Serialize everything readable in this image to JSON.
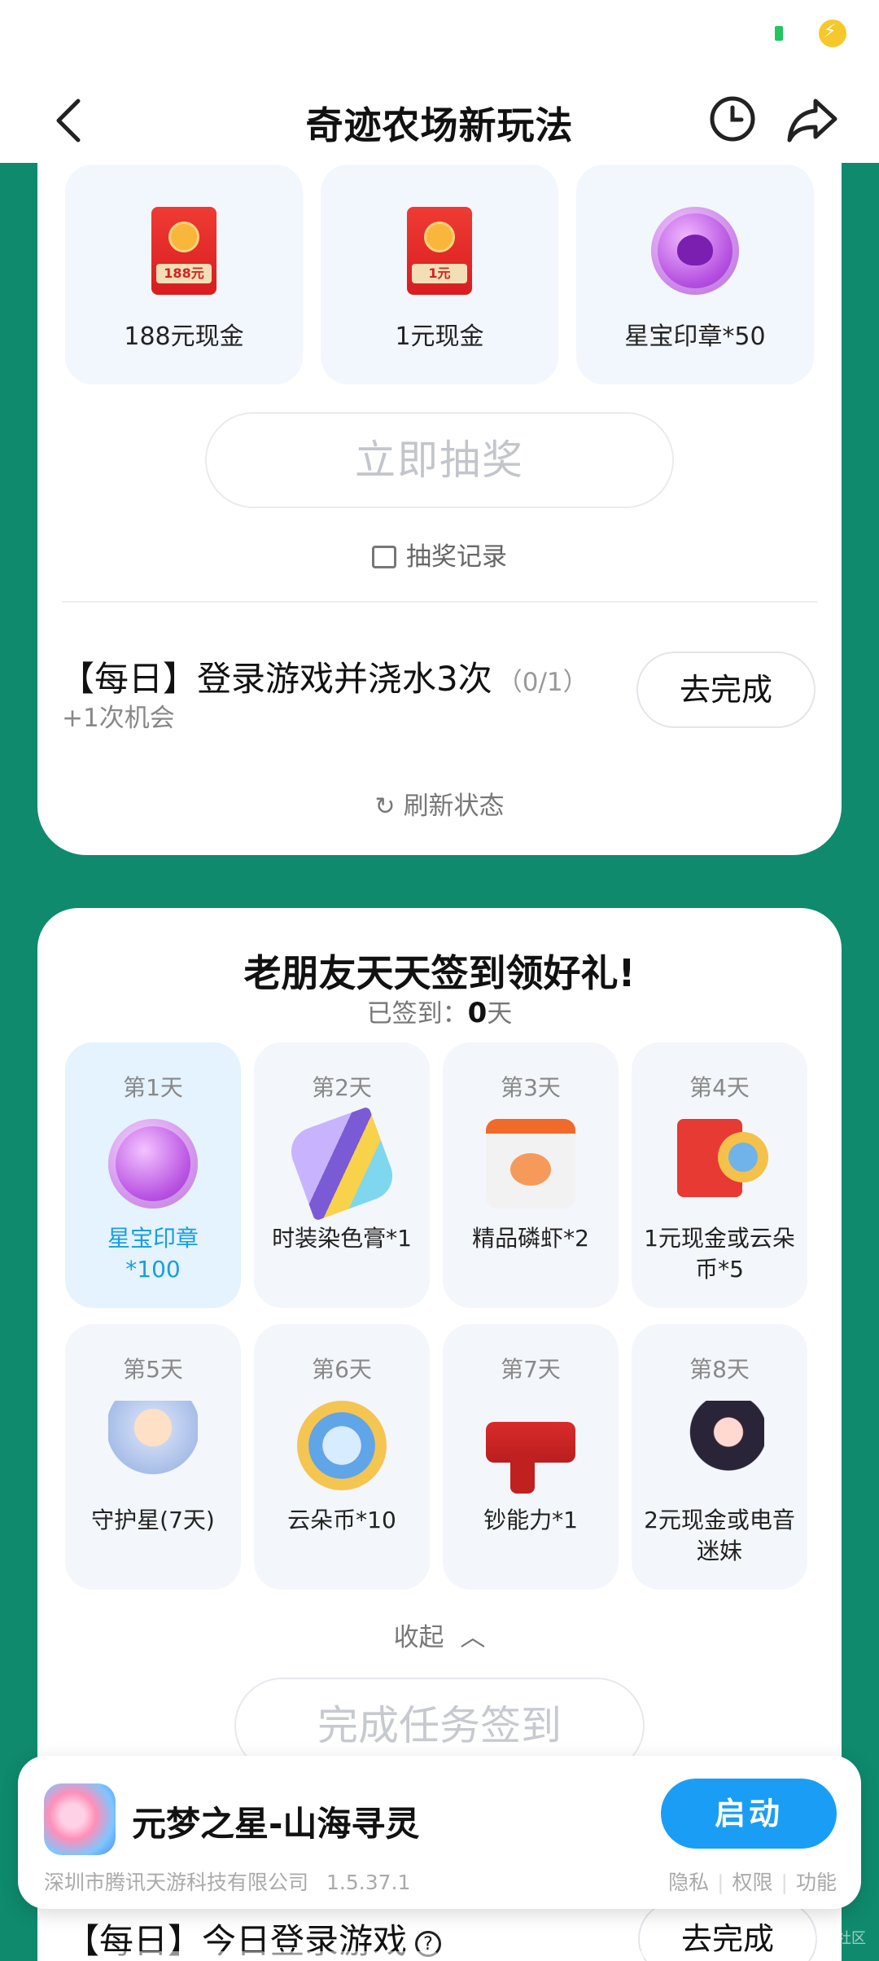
{
  "header": {
    "title": "奇迹农场新玩法"
  },
  "lottery": {
    "prizes": [
      {
        "label": "188元现金",
        "badge": "188元",
        "icon": "red-envelope"
      },
      {
        "label": "1元现金",
        "badge": "1元",
        "icon": "red-envelope"
      },
      {
        "label": "星宝印章*50",
        "icon": "star-seal"
      }
    ],
    "draw_label": "立即抽奖",
    "record_label": "抽奖记录",
    "task": {
      "title": "【每日】登录游戏并浇水3次",
      "progress": "（0/1）",
      "reward": "+1次机会",
      "button": "去完成"
    },
    "refresh_label": "刷新状态"
  },
  "signin": {
    "title": "老朋友天天签到领好礼!",
    "signed_prefix": "已签到：",
    "signed_count": "0",
    "signed_suffix": "天",
    "days": [
      {
        "day": "第1天",
        "name": "星宝印章\n*100",
        "icon": "star-seal"
      },
      {
        "day": "第2天",
        "name": "时装染色膏*1",
        "icon": "dye-tube"
      },
      {
        "day": "第3天",
        "name": "精品磷虾*2",
        "icon": "shrimp-pack"
      },
      {
        "day": "第4天",
        "name": "1元现金或云朵币*5",
        "icon": "envelope-coin"
      },
      {
        "day": "第5天",
        "name": "守护星(7天)",
        "icon": "guardian-doll"
      },
      {
        "day": "第6天",
        "name": "云朵币*10",
        "icon": "cloud-coin"
      },
      {
        "day": "第7天",
        "name": "钞能力*1",
        "icon": "money-gun"
      },
      {
        "day": "第8天",
        "name": "2元现金或电音迷妹",
        "icon": "envelope-girl"
      }
    ],
    "collapse_label": "收起",
    "finish_label": "完成任务签到"
  },
  "bottom_task": {
    "title": "【每日】今日登录游戏",
    "button": "去完成"
  },
  "app": {
    "name": "元梦之星-山海寻灵",
    "launch_label": "启动",
    "developer": "深圳市腾讯天游科技有限公司",
    "version": "1.5.37.1",
    "links": [
      "隐私",
      "权限",
      "功能"
    ]
  },
  "watermark": "游戏社区",
  "colors": {
    "background": "#0f8a6c",
    "accent": "#1a9ef5",
    "active_day": "#e4f3fe"
  }
}
